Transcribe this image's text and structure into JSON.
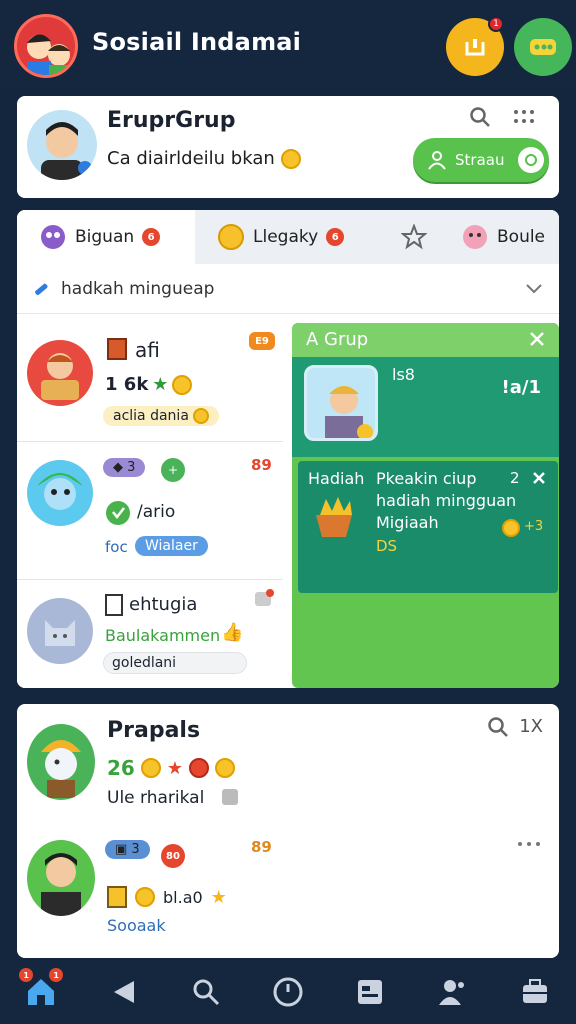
{
  "app": {
    "title": "Sosiail Indamai"
  },
  "group_card": {
    "title": "EruprGrup",
    "subtitle": "Ca diairldeilu bkan",
    "search_button": "Straau"
  },
  "tabs": [
    {
      "label": "Biguan",
      "badge": "6"
    },
    {
      "label": "Llegaky",
      "badge": "6"
    },
    {
      "label": "Boule"
    }
  ],
  "filter": {
    "label": "hadkah mingueap"
  },
  "list": [
    {
      "name": "afi",
      "badge": "E9",
      "stat": "1 6k",
      "pill": "aclia dania"
    },
    {
      "name": "3",
      "badge": "89",
      "line": "/ario",
      "prefix": "foc",
      "pill": "Wialaer"
    },
    {
      "name": "ehtugia",
      "line": "Baulakammen",
      "pill": "goledlani"
    }
  ],
  "green_panel": {
    "header": "A Grup",
    "user_label": "ls8",
    "counter": "!a/1",
    "reward_title": "Hadiah",
    "reward_name": "Pkeakin ciup",
    "reward_count": "2",
    "reward_desc": "hadiah mingguan",
    "reward_sub": "Migiaah",
    "reward_amount": "DS",
    "reward_pts": "+3"
  },
  "props_card": {
    "title": "Prapals",
    "count": "1X",
    "row1": {
      "value": "26",
      "line": "Ule rharikal"
    },
    "row2": {
      "badge": "3",
      "badge2": "80",
      "tag": "89",
      "value": "bl.a0",
      "line": "Sooaak"
    }
  },
  "nav": {
    "home_badge": "1",
    "home_badge2": "1"
  },
  "topbar": {
    "badge_left": "1"
  },
  "colors": {
    "background": "#13263d",
    "green": "#62c54f",
    "accent_yellow": "#f5b61d"
  }
}
